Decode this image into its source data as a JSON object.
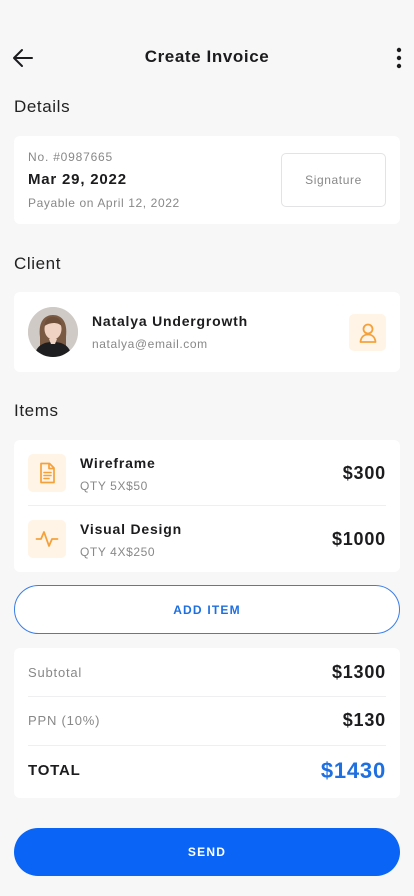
{
  "header": {
    "title": "Create Invoice"
  },
  "details": {
    "section_title": "Details",
    "invoice_no": "No. #0987665",
    "date": "Mar 29, 2022",
    "payable": "Payable on April 12, 2022",
    "signature_label": "Signature"
  },
  "client": {
    "section_title": "Client",
    "name": "Natalya Undergrowth",
    "email": "natalya@email.com"
  },
  "items": {
    "section_title": "Items",
    "list": [
      {
        "name": "Wireframe",
        "qty": "QTY 5X$50",
        "price": "$300",
        "icon": "document-icon"
      },
      {
        "name": "Visual Design",
        "qty": "QTY 4X$250",
        "price": "$1000",
        "icon": "activity-icon"
      }
    ],
    "add_label": "ADD ITEM"
  },
  "totals": {
    "subtotal_label": "Subtotal",
    "subtotal_value": "$1300",
    "tax_label": "PPN (10%)",
    "tax_value": "$130",
    "total_label": "TOTAL",
    "total_value": "$1430"
  },
  "send_label": "SEND",
  "colors": {
    "accent": "#0a64f5",
    "icon_orange": "#f5a13b",
    "icon_bg": "#fff4e6",
    "background": "#f7f7f8"
  }
}
